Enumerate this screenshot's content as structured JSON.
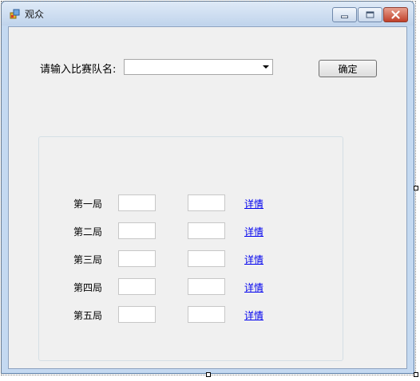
{
  "window": {
    "title": "观众",
    "icon": "app-form-icon",
    "controls": [
      "minimize-icon",
      "maximize-icon",
      "close-icon"
    ]
  },
  "form": {
    "team_prompt": "请输入比赛队名:",
    "team_select": {
      "value": "",
      "placeholder": ""
    },
    "confirm_label": "确定"
  },
  "rounds": [
    {
      "label": "第一局",
      "score_a": "",
      "score_b": "",
      "detail": "详情"
    },
    {
      "label": "第二局",
      "score_a": "",
      "score_b": "",
      "detail": "详情"
    },
    {
      "label": "第三局",
      "score_a": "",
      "score_b": "",
      "detail": "详情"
    },
    {
      "label": "第四局",
      "score_a": "",
      "score_b": "",
      "detail": "详情"
    },
    {
      "label": "第五局",
      "score_a": "",
      "score_b": "",
      "detail": "详情"
    }
  ],
  "colors": {
    "titlebar": "#c4d9f1",
    "client": "#f0f0f0",
    "link": "#0000ee",
    "close_button": "#c0402a"
  }
}
